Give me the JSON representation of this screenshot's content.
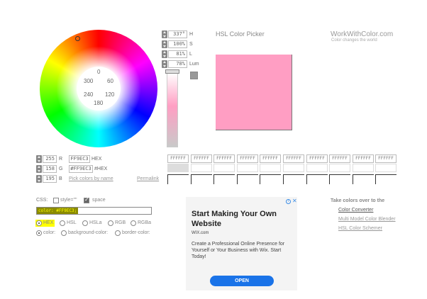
{
  "app": {
    "title": "HSL Color Picker",
    "site": "WorkWithColor.com",
    "tagline": "Color changes the world"
  },
  "wheel": {
    "labels": [
      "0",
      "300",
      "60",
      "240",
      "120",
      "180"
    ]
  },
  "hsl_fields": [
    {
      "value": "337°",
      "unit": "H"
    },
    {
      "value": "100%",
      "unit": "S"
    },
    {
      "value": "81%",
      "unit": "L"
    },
    {
      "value": "78%",
      "unit": "Lum"
    }
  ],
  "rgb_fields": [
    {
      "value": "255",
      "unit": "R"
    },
    {
      "value": "158",
      "unit": "G"
    },
    {
      "value": "195",
      "unit": "B"
    }
  ],
  "hex": {
    "value": "FF9EC3",
    "label": "HEX",
    "hash_value": "#FF9EC3",
    "hash_label": "#HEX"
  },
  "links": {
    "pick_by_name": "Pick colors by name",
    "permalink": "Permalink"
  },
  "colors": {
    "current": "#ff9ec3",
    "highlight_bg": "#8b8b00",
    "highlight_fg": "#ffff00",
    "ad_button": "#1a73e8"
  },
  "palette": {
    "labels": [
      "FFFFFF",
      "FFFFFF",
      "FFFFFF",
      "FFFFFF",
      "FFFFFF",
      "FFFFFF",
      "FFFFFF",
      "FFFFFF",
      "FFFFFF",
      "FFFFFF"
    ]
  },
  "css": {
    "label": "CSS:",
    "style_label": "style=\"\"",
    "space_label": "space",
    "output": "color: #FF9EC3;",
    "format_options": [
      "HEX",
      "HSL",
      "HSLa",
      "RGB",
      "RGBa"
    ],
    "property_options": [
      "color:",
      "background-color:",
      "border-color:"
    ]
  },
  "ad": {
    "headline": "Start Making Your Own Website",
    "domain": "WIX.com",
    "body": "Create a Professional Online Presence for Yourself or Your Business with Wix. Start Today!",
    "button": "OPEN",
    "info_icon": "i",
    "close_icon": "✕"
  },
  "take_colors": {
    "title": "Take colors over to the",
    "links": [
      "Color Converter",
      "Multi Model Color Blender",
      "HSL Color Schemer"
    ]
  }
}
